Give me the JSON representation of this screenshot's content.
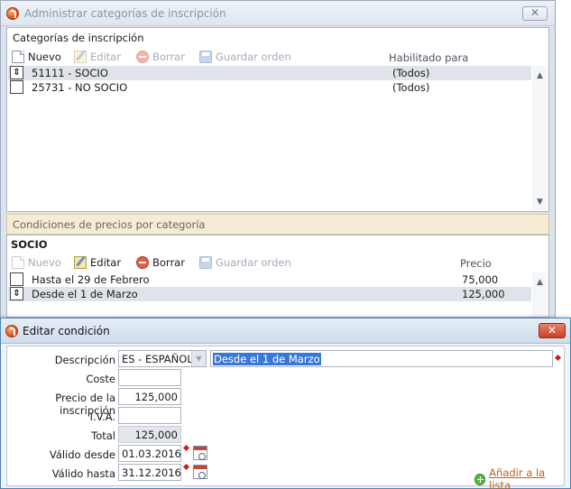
{
  "back_window": {
    "title": "Administrar categorías de inscripción",
    "close_glyph": "✕",
    "categories": {
      "section_title": "Categorías de inscripción",
      "toolbar": {
        "new_label": "Nuevo",
        "edit_label": "Editar",
        "delete_label": "Borrar",
        "save_order_label": "Guardar orden"
      },
      "column_habilitado": "Habilitado para",
      "rows": [
        {
          "name": "51111 - SOCIO",
          "enabled_for": "(Todos)",
          "selected": true,
          "handle": "⇕"
        },
        {
          "name": "25731 - NO SOCIO",
          "enabled_for": "(Todos)",
          "selected": false,
          "handle": ""
        }
      ]
    },
    "pricing": {
      "section_title": "Condiciones de precios por categoría",
      "category_name": "SOCIO",
      "toolbar": {
        "new_label": "Nuevo",
        "edit_label": "Editar",
        "delete_label": "Borrar",
        "save_order_label": "Guardar orden"
      },
      "column_price": "Precio",
      "rows": [
        {
          "label": "Hasta el 29 de Febrero",
          "price": "75,000",
          "selected": false,
          "handle": ""
        },
        {
          "label": "Desde el 1 de Marzo",
          "price": "125,000",
          "selected": true,
          "handle": "⇕"
        }
      ]
    }
  },
  "dialog": {
    "title": "Editar condición",
    "close_glyph": "✕",
    "fields": {
      "descripcion_label": "Descripción",
      "language_value": "ES - ESPAÑOL",
      "descripcion_value": "Desde el 1 de Marzo",
      "coste_label": "Coste",
      "coste_value": "",
      "precio_label": "Precio de la inscripción",
      "precio_value": "125,000",
      "iva_label": "I.V.A.",
      "iva_value": "",
      "total_label": "Total",
      "total_value": "125,000",
      "valido_desde_label": "Válido desde",
      "valido_desde_value": "01.03.2016",
      "valido_hasta_label": "Válido hasta",
      "valido_hasta_value": "31.12.2016"
    },
    "add_to_list_label": "Añadir a la lista"
  },
  "icons": {
    "app": "app-logo-icon",
    "new": "new-document-icon",
    "edit": "edit-pencil-icon",
    "delete": "delete-icon",
    "save": "save-disk-icon",
    "calendar": "calendar-icon",
    "add": "add-circle-icon"
  },
  "colors": {
    "selection": "#dfe4ea",
    "pricing_header_bg": "#f6ecd5",
    "dialog_close": "#c8412a",
    "required_marker": "#d11a1a",
    "link": "#b5651d",
    "text_selection": "#3a78d8"
  }
}
